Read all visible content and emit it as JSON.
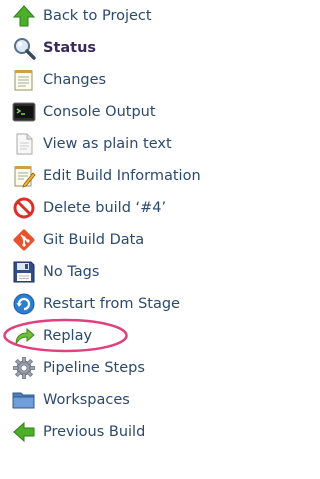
{
  "tasks": [
    {
      "label": "Back to Project",
      "icon": "up-arrow-icon",
      "bold": false
    },
    {
      "label": "Status",
      "icon": "magnifier-icon",
      "bold": true
    },
    {
      "label": "Changes",
      "icon": "notepad-icon",
      "bold": false
    },
    {
      "label": "Console Output",
      "icon": "terminal-icon",
      "bold": false
    },
    {
      "label": "View as plain text",
      "icon": "document-icon",
      "bold": false
    },
    {
      "label": "Edit Build Information",
      "icon": "notepad-pencil-icon",
      "bold": false
    },
    {
      "label": "Delete build ‘#4’",
      "icon": "no-entry-icon",
      "bold": false
    },
    {
      "label": "Git Build Data",
      "icon": "git-icon",
      "bold": false
    },
    {
      "label": "No Tags",
      "icon": "floppy-disk-icon",
      "bold": false
    },
    {
      "label": "Restart from Stage",
      "icon": "restart-icon",
      "bold": false
    },
    {
      "label": "Replay",
      "icon": "replay-arrow-icon",
      "bold": false
    },
    {
      "label": "Pipeline Steps",
      "icon": "gear-icon",
      "bold": false
    },
    {
      "label": "Workspaces",
      "icon": "folder-icon",
      "bold": false
    },
    {
      "label": "Previous Build",
      "icon": "left-arrow-icon",
      "bold": false
    }
  ],
  "highlight_color": "#e0407e"
}
